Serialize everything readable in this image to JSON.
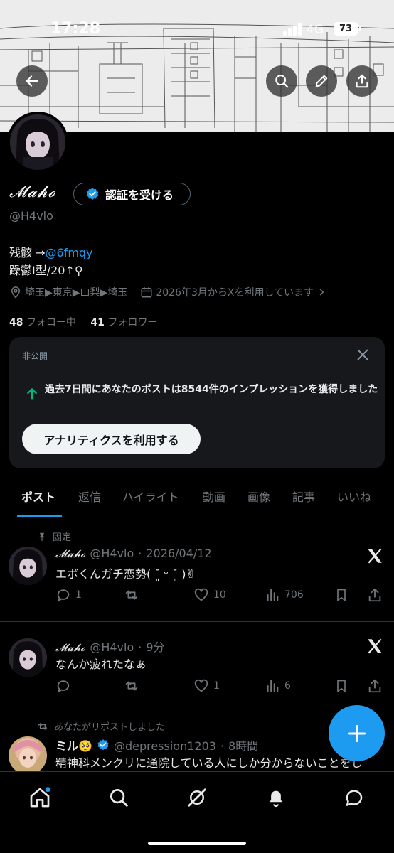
{
  "status_bar": {
    "time": "17:28",
    "network": "4G",
    "battery": "73"
  },
  "header": {
    "back_icon": "arrow-left-icon",
    "search_icon": "search-icon",
    "edit_icon": "pencil-icon",
    "share_icon": "share-icon"
  },
  "profile": {
    "name": "𝓜𝓪𝓱𝓸",
    "verify_button_label": "認証を受ける",
    "handle": "@H4vlo",
    "bio_line1_prefix": "残骸 →",
    "bio_line1_mention": "@6fmqy",
    "bio_line2": "躁鬱Ⅰ型/20↑♀",
    "location": "埼玉▶東京▶山梨▶埼玉",
    "joined": "2026年3月からXを利用しています",
    "following_count": "48",
    "following_label": "フォロー中",
    "followers_count": "41",
    "followers_label": "フォロワー"
  },
  "analytics_card": {
    "private_label": "非公開",
    "message": "過去7日間にあなたのポストは8544件のインプレッションを獲得しました",
    "button_label": "アナリティクスを利用する"
  },
  "tabs": [
    {
      "label": "ポスト",
      "active": true
    },
    {
      "label": "返信"
    },
    {
      "label": "ハイライト"
    },
    {
      "label": "動画"
    },
    {
      "label": "画像"
    },
    {
      "label": "記事"
    },
    {
      "label": "いいね"
    }
  ],
  "posts": [
    {
      "pinned_label": "固定",
      "name": "𝓜𝓪𝓱𝓸",
      "handle": "@H4vlo",
      "time": "2026/04/12",
      "text": "エボくんガチ恋勢( ˘͈ ᵕ ˘͈ )✌︎",
      "replies": "1",
      "reposts": "",
      "likes": "10",
      "views": "706"
    },
    {
      "name": "𝓜𝓪𝓱𝓸",
      "handle": "@H4vlo",
      "time": "9分",
      "text": "なんか疲れたなぁ",
      "replies": "",
      "reposts": "",
      "likes": "1",
      "views": "6"
    },
    {
      "repost_label": "あなたがリポストしました",
      "name": "ミル🥺",
      "handle": "@depression1203",
      "time": "8時間",
      "text": "精神科メンクリに通院している人にしか分からないことをし"
    }
  ],
  "colors": {
    "accent": "#1d9bf0",
    "bg": "#000000",
    "muted": "#71767b",
    "card": "#16181c",
    "green": "#00ba7c"
  },
  "nav": [
    "home-icon",
    "search-icon",
    "grok-icon",
    "notifications-icon",
    "messages-icon"
  ]
}
